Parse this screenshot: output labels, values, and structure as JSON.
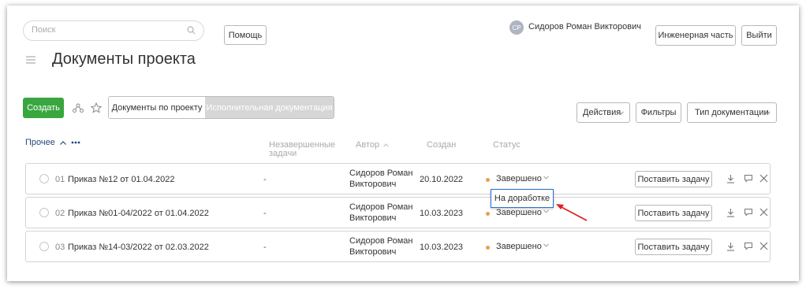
{
  "header": {
    "search_placeholder": "Поиск",
    "help_label": "Помощь",
    "avatar_initials": "СР",
    "user_name": "Сидоров Роман Викторович",
    "engineering_label": "Инженерная часть",
    "logout_label": "Выйти"
  },
  "page": {
    "title": "Документы проекта"
  },
  "toolbar": {
    "create_label": "Создать",
    "tab_project_docs": "Документы по проекту",
    "tab_exec_docs": "Исполнительная документация",
    "actions_label": "Действия",
    "filters_label": "Фильтры",
    "doc_type_label": "Тип документации"
  },
  "table": {
    "col_incomplete_line1": "Незавершенные",
    "col_incomplete_line2": "задачи",
    "col_author": "Автор",
    "col_created": "Создан",
    "col_status": "Статус",
    "group_label": "Прочее",
    "rows": [
      {
        "num": "01",
        "name": "Приказ №12 от 01.04.2022",
        "incomplete": "-",
        "author_line1": "Сидоров Роман",
        "author_line2": "Викторович",
        "created": "20.10.2022",
        "status": "Завершено",
        "task_label": "Поставить задачу"
      },
      {
        "num": "02",
        "name": "Приказ №01-04/2022 от 01.04.2022",
        "incomplete": "-",
        "author_line1": "Сидоров Роман",
        "author_line2": "Викторович",
        "created": "10.03.2023",
        "status": "Завершено",
        "task_label": "Поставить задачу"
      },
      {
        "num": "03",
        "name": "Приказ №14-03/2022 от 02.03.2022",
        "incomplete": "-",
        "author_line1": "Сидоров Роман",
        "author_line2": "Викторович",
        "created": "10.03.2023",
        "status": "Завершено",
        "task_label": "Поставить задачу"
      }
    ]
  },
  "status_dropdown": {
    "option": "На доработке"
  },
  "colors": {
    "create_green": "#3aa640",
    "status_dot": "#e3a050",
    "group_link": "#23477f",
    "popup_border": "#2a6fd6",
    "annotation_arrow": "#e02020"
  }
}
